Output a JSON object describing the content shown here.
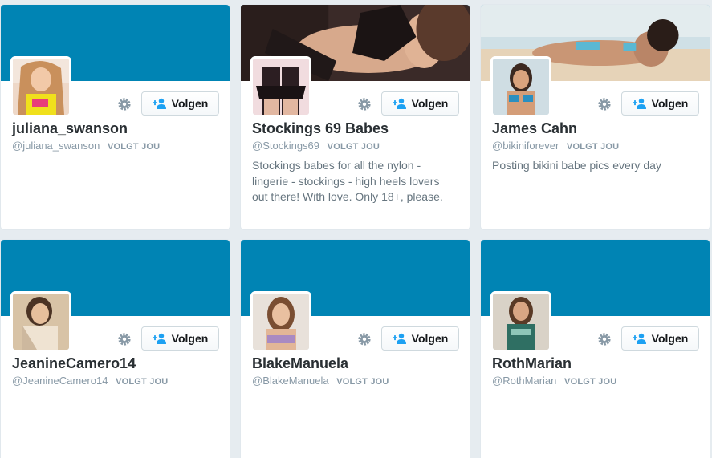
{
  "labels": {
    "follow_button": "Volgen",
    "follows_you": "VOLGT JOU"
  },
  "colors": {
    "banner_default": "#0084b4",
    "follow_icon": "#1da1f2"
  },
  "icons": {
    "settings": "gear-icon",
    "follow": "add-user-icon"
  },
  "cards": [
    {
      "name": "juliana_swanson",
      "handle": "@juliana_swanson",
      "bio": ""
    },
    {
      "name": "Stockings 69 Babes",
      "handle": "@Stockings69",
      "bio": "Stockings babes for all the nylon - lingerie - stockings - high heels lovers out there! With love. Only 18+, please."
    },
    {
      "name": "James Cahn",
      "handle": "@bikiniforever",
      "bio": "Posting bikini babe pics every day"
    },
    {
      "name": "JeanineCamero14",
      "handle": "@JeanineCamero14",
      "bio": ""
    },
    {
      "name": "BlakeManuela",
      "handle": "@BlakeManuela",
      "bio": ""
    },
    {
      "name": "RothMarian",
      "handle": "@RothMarian",
      "bio": ""
    }
  ]
}
